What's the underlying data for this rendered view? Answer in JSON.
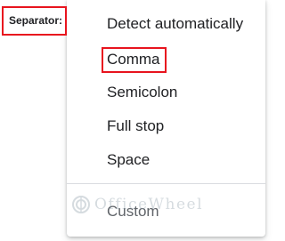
{
  "separator": {
    "label": "Separator:"
  },
  "menu": {
    "items": [
      {
        "label": "Detect automatically"
      },
      {
        "label": "Comma"
      },
      {
        "label": "Semicolon"
      },
      {
        "label": "Full stop"
      },
      {
        "label": "Space"
      },
      {
        "label": "Custom"
      }
    ]
  },
  "watermark": {
    "text": "OfficeWheel",
    "icon": "officewheel-logo-icon"
  },
  "colors": {
    "highlight": "#e8141e",
    "text": "#202124"
  }
}
